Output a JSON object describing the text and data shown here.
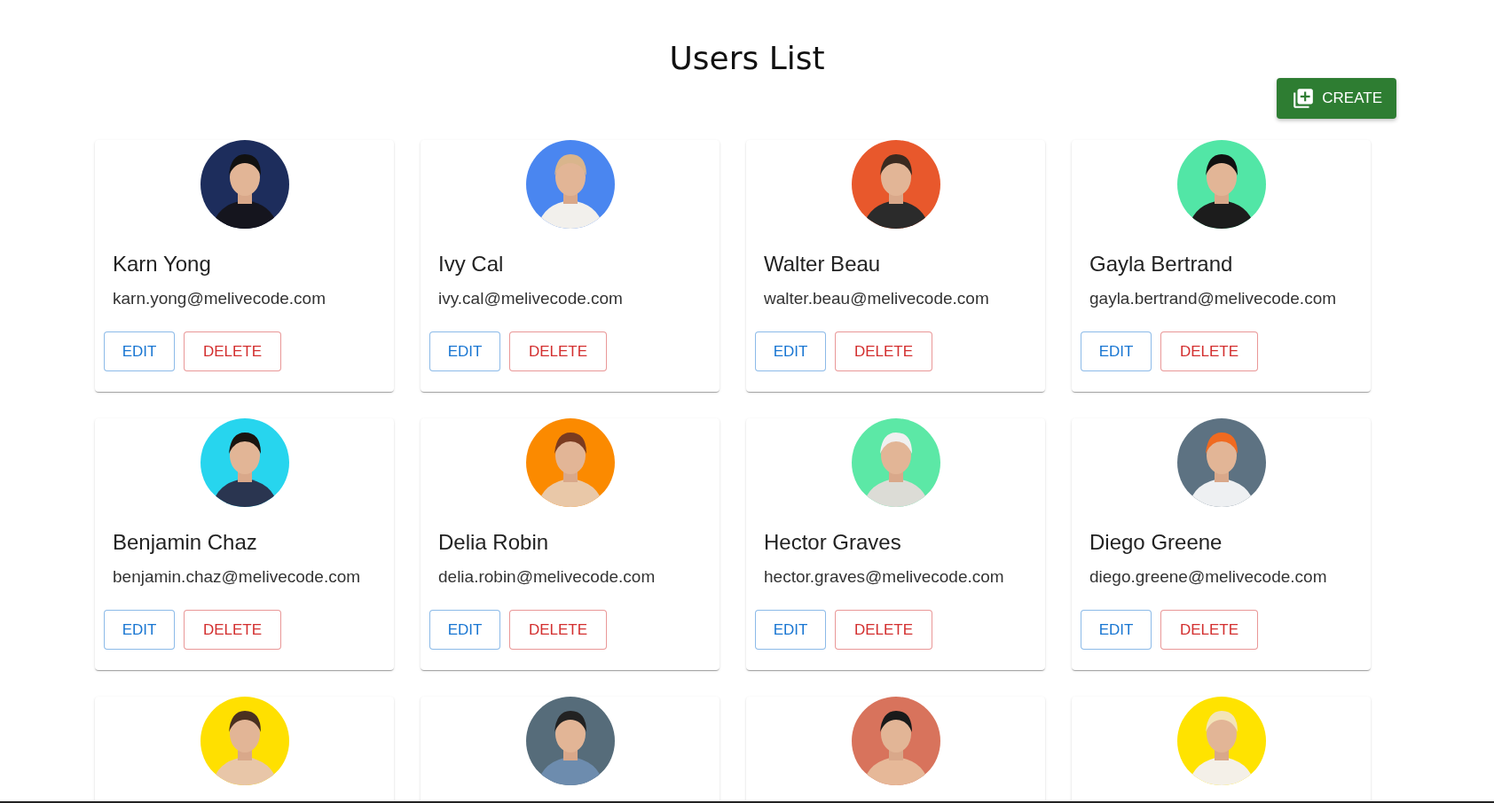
{
  "title": "Users List",
  "create_button": {
    "label": "CREATE"
  },
  "users": [
    {
      "avatar": {
        "kind": "picture"
      },
      "name": "Karn Yong",
      "email": "karn.yong@melivecode.com",
      "actions": [
        {
          "label": "EDIT",
          "kind": "edit"
        },
        {
          "label": "DELETE",
          "kind": "delete"
        }
      ]
    },
    {
      "avatar": {
        "kind": "picture"
      },
      "name": "Ivy Cal",
      "email": "ivy.cal@melivecode.com",
      "actions": [
        {
          "label": "EDIT",
          "kind": "edit"
        },
        {
          "label": "DELETE",
          "kind": "delete"
        }
      ]
    },
    {
      "avatar": {
        "kind": "picture"
      },
      "name": "Walter Beau",
      "email": "walter.beau@melivecode.com",
      "actions": [
        {
          "label": "EDIT",
          "kind": "edit"
        },
        {
          "label": "DELETE",
          "kind": "delete"
        }
      ]
    },
    {
      "avatar": {
        "kind": "picture"
      },
      "name": "Gayla Bertrand",
      "email": "gayla.bertrand@melivecode.com",
      "actions": [
        {
          "label": "EDIT",
          "kind": "edit"
        },
        {
          "label": "DELETE",
          "kind": "delete"
        }
      ]
    },
    {
      "avatar": {
        "kind": "picture"
      },
      "name": "Benjamin Chaz",
      "email": "benjamin.chaz@melivecode.com",
      "actions": [
        {
          "label": "EDIT",
          "kind": "edit"
        },
        {
          "label": "DELETE",
          "kind": "delete"
        }
      ]
    },
    {
      "avatar": {
        "kind": "picture"
      },
      "name": "Delia Robin",
      "email": "delia.robin@melivecode.com",
      "actions": [
        {
          "label": "EDIT",
          "kind": "edit"
        },
        {
          "label": "DELETE",
          "kind": "delete"
        }
      ]
    },
    {
      "avatar": {
        "kind": "picture"
      },
      "name": "Hector Graves",
      "email": "hector.graves@melivecode.com",
      "actions": [
        {
          "label": "EDIT",
          "kind": "edit"
        },
        {
          "label": "DELETE",
          "kind": "delete"
        }
      ]
    },
    {
      "avatar": {
        "kind": "picture"
      },
      "name": "Diego Greene",
      "email": "diego.greene@melivecode.com",
      "actions": [
        {
          "label": "EDIT",
          "kind": "edit"
        },
        {
          "label": "DELETE",
          "kind": "delete"
        }
      ]
    },
    {
      "avatar": {
        "kind": "picture"
      }
    },
    {
      "avatar": {
        "kind": "picture"
      }
    },
    {
      "avatar": {
        "kind": "picture"
      }
    },
    {
      "avatar": {
        "kind": "picture"
      }
    }
  ]
}
